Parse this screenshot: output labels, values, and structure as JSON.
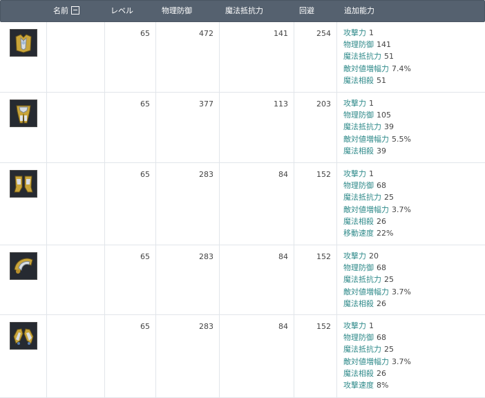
{
  "header": {
    "name": "名前",
    "level": "レベル",
    "phys_def": "物理防御",
    "mag_res": "魔法抵抗力",
    "evasion": "回避",
    "bonus": "追加能力"
  },
  "rows": [
    {
      "icon": "gold-chest-armor-icon",
      "level": "65",
      "phys_def": "472",
      "mag_res": "141",
      "evasion": "254",
      "bonuses": [
        {
          "label": "攻撃力",
          "value": "1"
        },
        {
          "label": "物理防御",
          "value": "141"
        },
        {
          "label": "魔法抵抗力",
          "value": "51"
        },
        {
          "label": "敵対値増幅力",
          "value": "7.4%"
        },
        {
          "label": "魔法相殺",
          "value": "51"
        }
      ]
    },
    {
      "icon": "gold-leg-armor-icon",
      "level": "65",
      "phys_def": "377",
      "mag_res": "113",
      "evasion": "203",
      "bonuses": [
        {
          "label": "攻撃力",
          "value": "1"
        },
        {
          "label": "物理防御",
          "value": "105"
        },
        {
          "label": "魔法抵抗力",
          "value": "39"
        },
        {
          "label": "敵対値増幅力",
          "value": "5.5%"
        },
        {
          "label": "魔法相殺",
          "value": "39"
        }
      ]
    },
    {
      "icon": "gold-boots-icon",
      "level": "65",
      "phys_def": "283",
      "mag_res": "84",
      "evasion": "152",
      "bonuses": [
        {
          "label": "攻撃力",
          "value": "1"
        },
        {
          "label": "物理防御",
          "value": "68"
        },
        {
          "label": "魔法抵抗力",
          "value": "25"
        },
        {
          "label": "敵対値増幅力",
          "value": "3.7%"
        },
        {
          "label": "魔法相殺",
          "value": "26"
        },
        {
          "label": "移動速度",
          "value": "22%"
        }
      ]
    },
    {
      "icon": "gold-shoulder-armor-icon",
      "level": "65",
      "phys_def": "283",
      "mag_res": "84",
      "evasion": "152",
      "bonuses": [
        {
          "label": "攻撃力",
          "value": "20"
        },
        {
          "label": "物理防御",
          "value": "68"
        },
        {
          "label": "魔法抵抗力",
          "value": "25"
        },
        {
          "label": "敵対値増幅力",
          "value": "3.7%"
        },
        {
          "label": "魔法相殺",
          "value": "26"
        }
      ]
    },
    {
      "icon": "gold-gloves-icon",
      "level": "65",
      "phys_def": "283",
      "mag_res": "84",
      "evasion": "152",
      "bonuses": [
        {
          "label": "攻撃力",
          "value": "1"
        },
        {
          "label": "物理防御",
          "value": "68"
        },
        {
          "label": "魔法抵抗力",
          "value": "25"
        },
        {
          "label": "敵対値増幅力",
          "value": "3.7%"
        },
        {
          "label": "魔法相殺",
          "value": "26"
        },
        {
          "label": "攻撃速度",
          "value": "8%"
        }
      ]
    }
  ]
}
